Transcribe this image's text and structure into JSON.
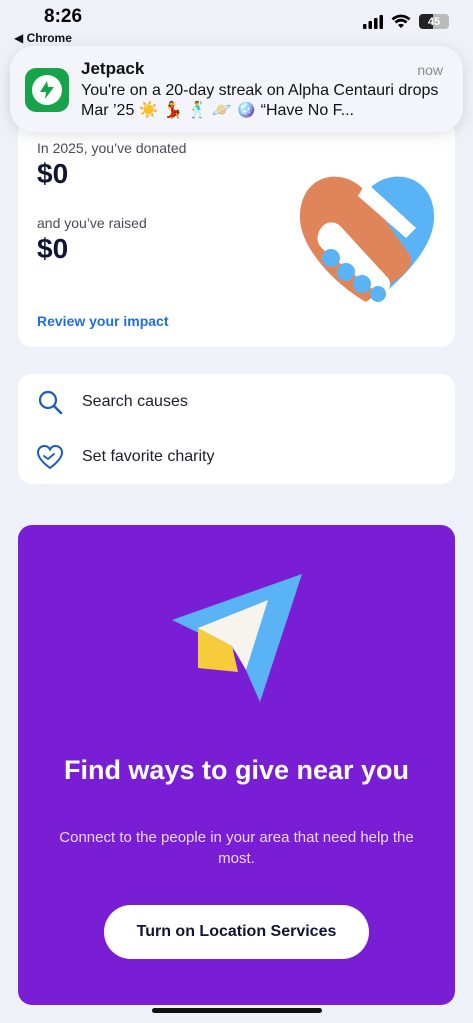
{
  "status_bar": {
    "time": "8:26",
    "back_app": "◀ Chrome",
    "battery": "45"
  },
  "notification": {
    "app": "Jetpack",
    "time": "now",
    "body": "You're on a 20-day streak on Alpha Centauri drops Mar ’25 ☀️ 💃 🕺 🪐 🪩 “Have No F..."
  },
  "impact": {
    "donated_label": "In 2025, you’ve donated",
    "donated_value": "$0",
    "raised_label": "and you’ve raised",
    "raised_value": "$0",
    "review_link": "Review your impact"
  },
  "menu": {
    "items": [
      {
        "label": "Search causes",
        "icon": "search-icon"
      },
      {
        "label": "Set favorite charity",
        "icon": "heart-outline-icon"
      }
    ]
  },
  "promo": {
    "title": "Find ways to give near you",
    "text": "Connect to the people in your area that need help the most.",
    "button": "Turn on Location Services",
    "bg_color": "#7a1ed6"
  }
}
